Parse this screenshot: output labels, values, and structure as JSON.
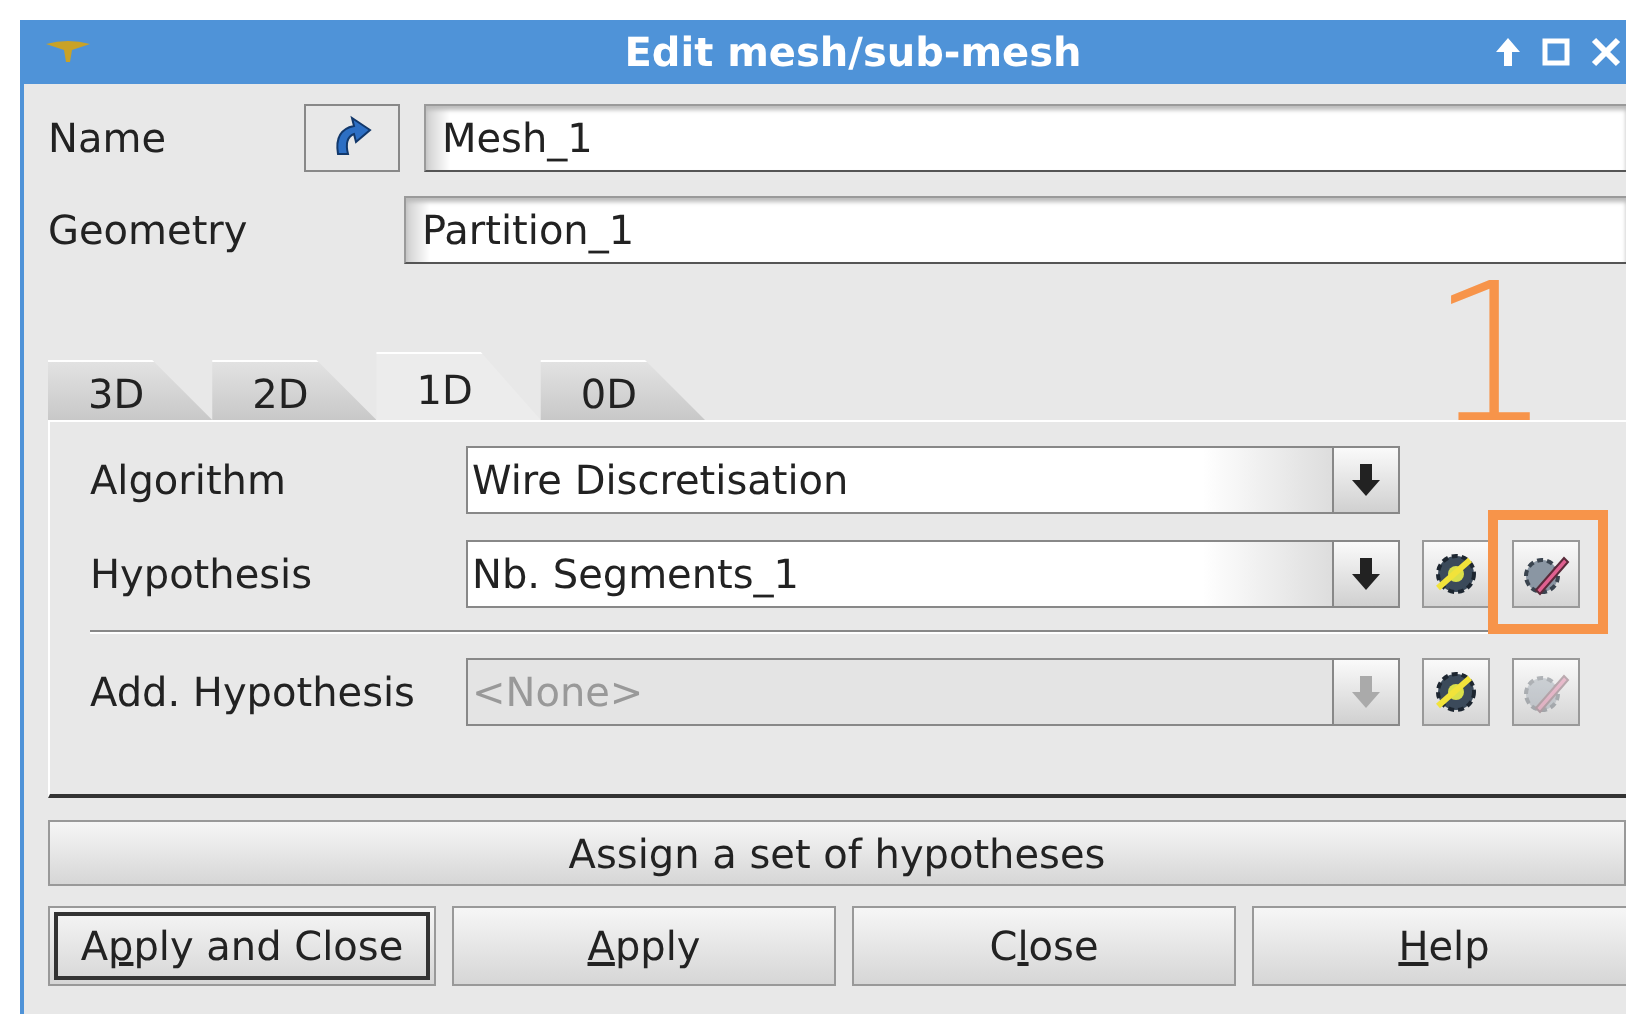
{
  "window": {
    "title": "Edit mesh/sub-mesh"
  },
  "name": {
    "label": "Name",
    "value": "Mesh_1"
  },
  "geometry": {
    "label": "Geometry",
    "value": "Partition_1"
  },
  "tabs": [
    {
      "label": "3D",
      "selected": false
    },
    {
      "label": "2D",
      "selected": false
    },
    {
      "label": "1D",
      "selected": true
    },
    {
      "label": "0D",
      "selected": false
    }
  ],
  "rows": [
    {
      "kind": "combo",
      "label": "Algorithm",
      "value": "Wire Discretisation",
      "disabled": false
    },
    {
      "kind": "combo",
      "label": "Hypothesis",
      "value": "Nb. Segments_1",
      "disabled": false,
      "tools": [
        {
          "kind": "create",
          "disabled": false
        },
        {
          "kind": "edit",
          "disabled": false,
          "highlighted": true
        }
      ]
    },
    {
      "kind": "separator"
    },
    {
      "kind": "combo",
      "label": "Add. Hypothesis",
      "value": "<None>",
      "disabled": true,
      "tools": [
        {
          "kind": "create",
          "disabled": false
        },
        {
          "kind": "edit",
          "disabled": true
        }
      ]
    }
  ],
  "annotation": {
    "text": "1"
  },
  "assign_button": "Assign a set of hypotheses",
  "buttons": [
    {
      "pre": "A",
      "key": "p",
      "post": "ply and Close",
      "default": true
    },
    {
      "key": "A",
      "post": "pply",
      "default": false
    },
    {
      "pre": "C",
      "key": "l",
      "post": "ose",
      "default": false
    },
    {
      "key": "H",
      "post": "elp",
      "default": false
    }
  ]
}
